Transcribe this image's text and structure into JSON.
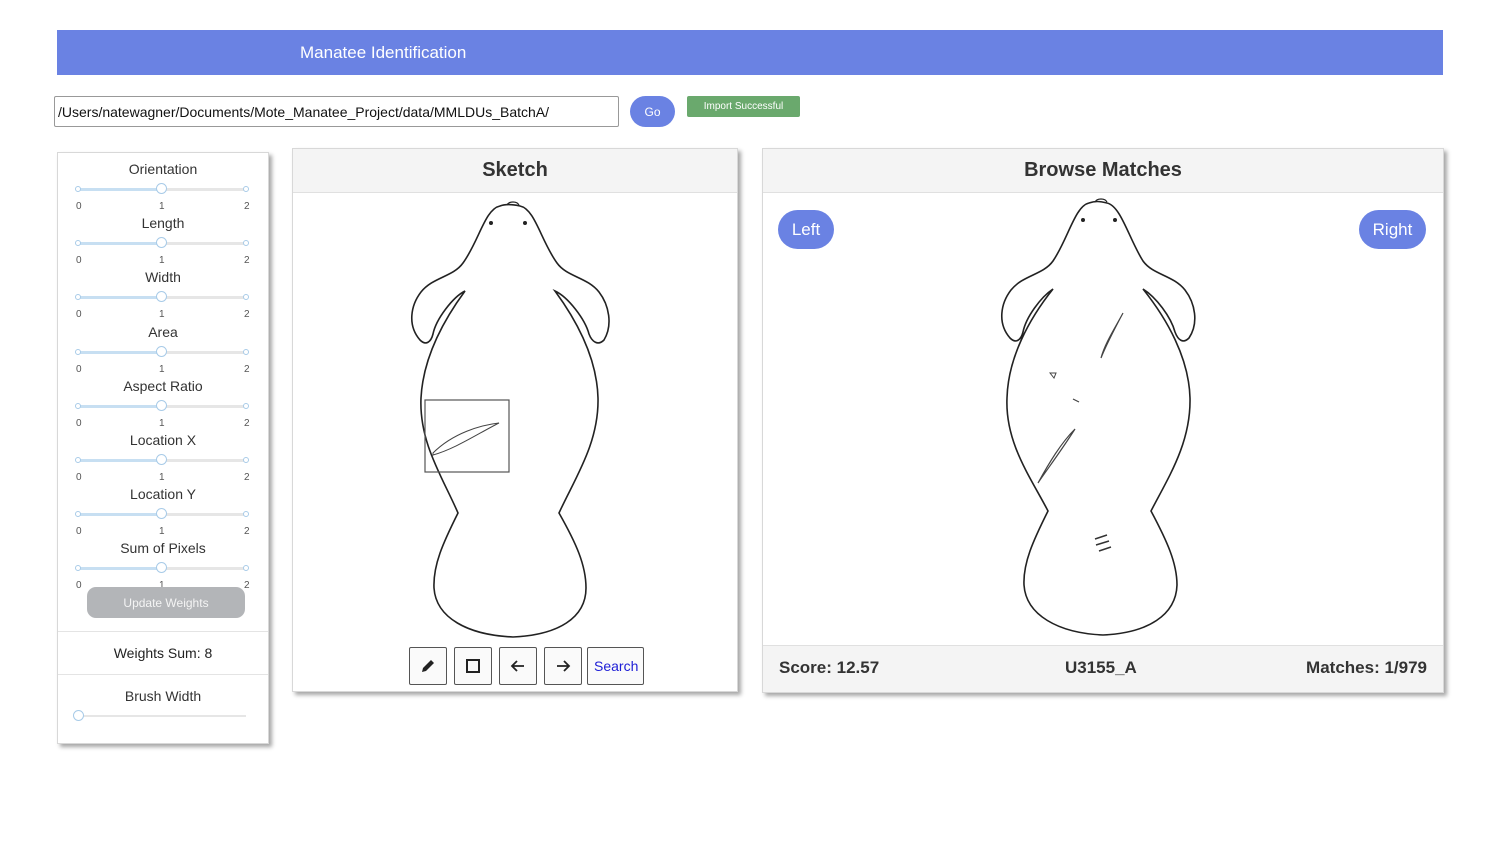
{
  "header": {
    "title": "Manatee Identification"
  },
  "import": {
    "path_value": "/Users/natewagner/Documents/Mote_Manatee_Project/data/MMLDUs_BatchA/",
    "go_label": "Go",
    "status": "Import Successful"
  },
  "weights": {
    "sliders": [
      {
        "label": "Orientation",
        "min": "0",
        "mid": "1",
        "max": "2",
        "value": 1
      },
      {
        "label": "Length",
        "min": "0",
        "mid": "1",
        "max": "2",
        "value": 1
      },
      {
        "label": "Width",
        "min": "0",
        "mid": "1",
        "max": "2",
        "value": 1
      },
      {
        "label": "Area",
        "min": "0",
        "mid": "1",
        "max": "2",
        "value": 1
      },
      {
        "label": "Aspect Ratio",
        "min": "0",
        "mid": "1",
        "max": "2",
        "value": 1
      },
      {
        "label": "Location X",
        "min": "0",
        "mid": "1",
        "max": "2",
        "value": 1
      },
      {
        "label": "Location Y",
        "min": "0",
        "mid": "1",
        "max": "2",
        "value": 1
      },
      {
        "label": "Sum of Pixels",
        "min": "0",
        "mid": "1",
        "max": "2",
        "value": 1
      }
    ],
    "update_label": "Update Weights",
    "sum_text": "Weights Sum: 8",
    "brush_label": "Brush Width",
    "brush_value": 0
  },
  "sketch": {
    "title": "Sketch",
    "tools": [
      "pencil-icon",
      "square-icon",
      "arrow-left-icon",
      "arrow-right-icon"
    ],
    "search_label": "Search"
  },
  "matches": {
    "title": "Browse Matches",
    "left_label": "Left",
    "right_label": "Right",
    "score": "Score: 12.57",
    "id": "U3155_A",
    "count": "Matches: 1/979"
  },
  "colors": {
    "accent": "#6a82e3",
    "success": "#6aa96d",
    "disabled": "#b3b5b8"
  }
}
